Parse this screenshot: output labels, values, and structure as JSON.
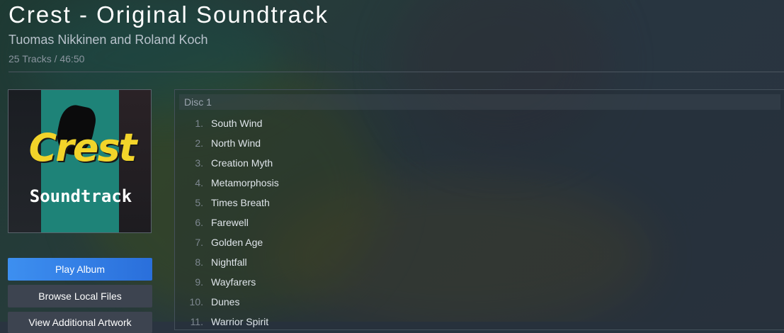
{
  "album": {
    "title": "Crest - Original Soundtrack",
    "artist": "Tuomas Nikkinen and Roland Koch",
    "meta": "25 Tracks / 46:50"
  },
  "cover": {
    "logo_text": "Crest",
    "logo_subtitle": "Soundtrack"
  },
  "buttons": {
    "play": "Play Album",
    "browse": "Browse Local Files",
    "artwork": "View Additional Artwork"
  },
  "disc": {
    "label": "Disc 1",
    "tracks": [
      {
        "num": "1.",
        "name": "South Wind"
      },
      {
        "num": "2.",
        "name": "North Wind"
      },
      {
        "num": "3.",
        "name": "Creation Myth"
      },
      {
        "num": "4.",
        "name": "Metamorphosis"
      },
      {
        "num": "5.",
        "name": "Times Breath"
      },
      {
        "num": "6.",
        "name": "Farewell"
      },
      {
        "num": "7.",
        "name": "Golden Age"
      },
      {
        "num": "8.",
        "name": "Nightfall"
      },
      {
        "num": "9.",
        "name": "Wayfarers"
      },
      {
        "num": "10.",
        "name": "Dunes"
      },
      {
        "num": "11.",
        "name": "Warrior Spirit"
      }
    ]
  },
  "colors": {
    "play_button": "#2f7fe6",
    "secondary_button": "#3d4450",
    "title_text": "#ffffff"
  }
}
